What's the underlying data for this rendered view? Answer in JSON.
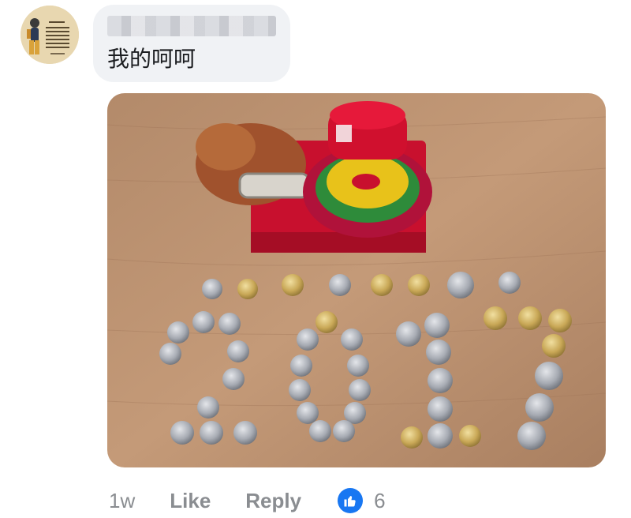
{
  "comment": {
    "author_name_redacted": true,
    "text": "我的呵呵"
  },
  "actions": {
    "time": "1w",
    "like_label": "Like",
    "reply_label": "Reply",
    "reaction_count": "6",
    "reaction_icon": "thumbs-up-icon"
  },
  "photo": {
    "coin_digits_shown": "2017"
  },
  "colors": {
    "like_blue": "#1877f2",
    "meta_gray": "#8a8d91",
    "bubble_bg": "#f0f2f5",
    "text_dark": "#1c1e21"
  }
}
